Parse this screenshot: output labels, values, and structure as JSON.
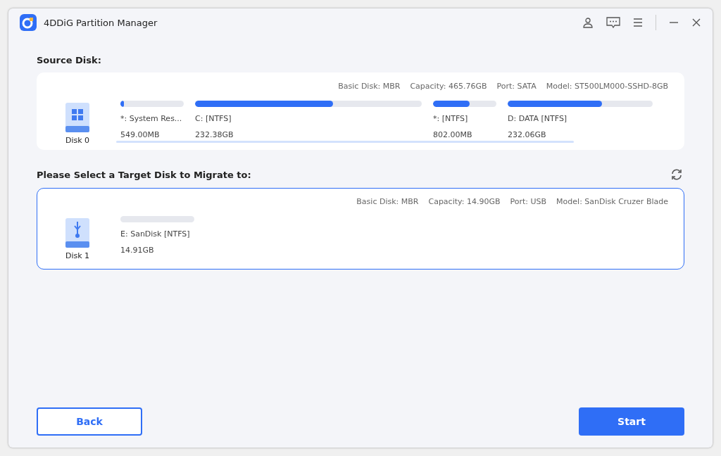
{
  "window": {
    "title": "4DDiG Partition Manager"
  },
  "source": {
    "heading": "Source Disk:",
    "disk": {
      "name": "Disk 0",
      "kind": "hdd",
      "selected": false,
      "info": [
        "Basic Disk: MBR",
        "Capacity: 465.76GB",
        "Port: SATA",
        "Model: ST500LM000-SSHD-8GB"
      ],
      "partitions": [
        {
          "label": "*: System Res...",
          "size": "549.00MB",
          "level": 0.06
        },
        {
          "label": "C:  [NTFS]",
          "size": "232.38GB",
          "level": 0.61
        },
        {
          "label": "*:  [NTFS]",
          "size": "802.00MB",
          "level": 0.58
        },
        {
          "label": "D: DATA [NTFS]",
          "size": "232.06GB",
          "level": 0.65
        }
      ]
    }
  },
  "target": {
    "heading": "Please Select a Target Disk to Migrate to:",
    "disk": {
      "name": "Disk 1",
      "kind": "usb",
      "selected": true,
      "info": [
        "Basic Disk: MBR",
        "Capacity: 14.90GB",
        "Port: USB",
        "Model: SanDisk Cruzer Blade"
      ],
      "partitions": [
        {
          "label": "E: SanDisk [NTFS]",
          "size": "14.91GB"
        }
      ]
    }
  },
  "buttons": {
    "back": "Back",
    "start": "Start"
  }
}
